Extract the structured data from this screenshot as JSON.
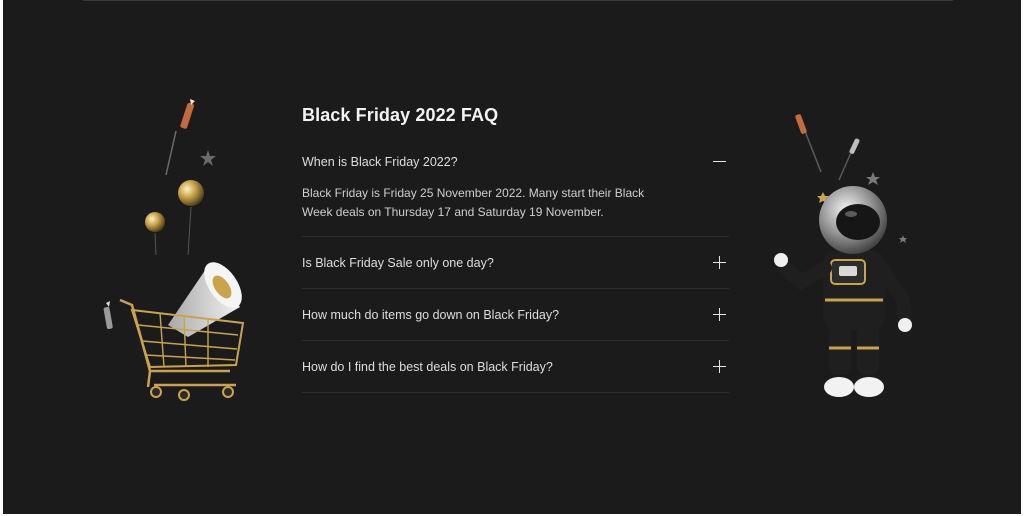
{
  "faq": {
    "title": "Black Friday 2022 FAQ",
    "items": [
      {
        "question": "When is Black Friday 2022?",
        "answer": "Black Friday is Friday 25 November 2022. Many start their Black Week deals on Thursday 17 and Saturday 19 November.",
        "expanded": true
      },
      {
        "question": "Is Black Friday Sale only one day?",
        "expanded": false
      },
      {
        "question": "How much do items go down on Black Friday?",
        "expanded": false
      },
      {
        "question": "How do I find the best deals on Black Friday?",
        "expanded": false
      }
    ]
  },
  "colors": {
    "background": "#1b1b1b",
    "gold": "#c9a44c",
    "text": "#dedede"
  },
  "icons": [
    "minus-icon",
    "plus-icon",
    "shopping-cart-illustration",
    "megaphone-illustration",
    "astronaut-illustration",
    "rocket-illustration",
    "balloon-illustration",
    "star-icon"
  ]
}
